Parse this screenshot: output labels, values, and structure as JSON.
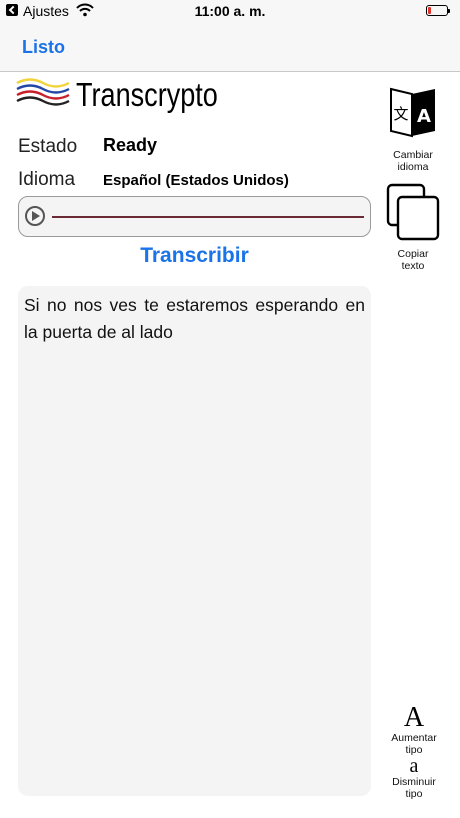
{
  "status_bar": {
    "back_label": "Ajustes",
    "time": "11:00 a. m.",
    "battery_color": "#e0332b"
  },
  "nav": {
    "done_label": "Listo",
    "accent_color": "#1a73e8"
  },
  "app": {
    "logo_text": "Transcrypto",
    "status_label": "Estado",
    "status_value": "Ready",
    "language_label": "Idioma",
    "language_value": "Español (Estados Unidos)",
    "transcribe_label": "Transcribir",
    "transcript_text": "Si no nos ves te estaremos esperando en la puerta de al lado"
  },
  "tools": {
    "change_language_line1": "Cambiar",
    "change_language_line2": "idioma",
    "copy_text_line1": "Copiar",
    "copy_text_line2": "texto",
    "increase_font_glyph": "A",
    "increase_font_line1": "Aumentar",
    "increase_font_line2": "tipo",
    "decrease_font_glyph": "a",
    "decrease_font_line1": "Disminuir",
    "decrease_font_line2": "tipo"
  },
  "icons": {
    "back": "back-arrow-icon",
    "wifi": "wifi-icon",
    "battery": "battery-icon",
    "play": "play-icon",
    "translate": "translate-icon",
    "copy": "copy-icon"
  }
}
